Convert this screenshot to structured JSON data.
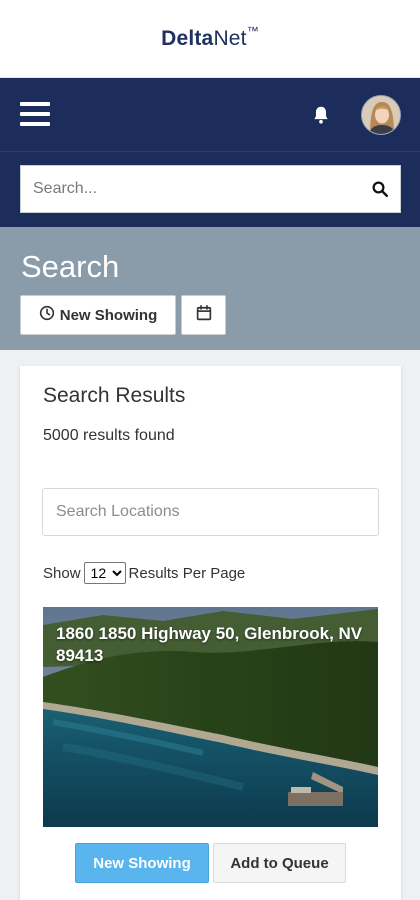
{
  "brand": {
    "bold": "Delta",
    "rest": "Net",
    "mark": "™"
  },
  "header": {
    "menu_icon": "hamburger-menu-icon",
    "notification_icon": "bell-icon",
    "avatar_icon": "user-avatar"
  },
  "search": {
    "placeholder": "Search...",
    "value": "",
    "icon": "search-icon"
  },
  "page": {
    "title": "Search",
    "new_showing_label": "New Showing",
    "new_showing_icon": "clock-icon",
    "calendar_icon": "calendar-icon"
  },
  "results": {
    "title": "Search Results",
    "count_text": "5000 results found",
    "location_placeholder": "Search Locations",
    "show_label": "Show",
    "per_page_selected": "12",
    "per_page_suffix": "Results Per Page"
  },
  "listings": [
    {
      "address": "1860 1850 Highway 50, Glenbrook, NV 89413",
      "primary_action": "New Showing",
      "secondary_action": "Add to Queue"
    }
  ],
  "colors": {
    "navy": "#1c2d5c",
    "slate": "#8a9ba9",
    "accent_blue": "#5ab4ee"
  }
}
